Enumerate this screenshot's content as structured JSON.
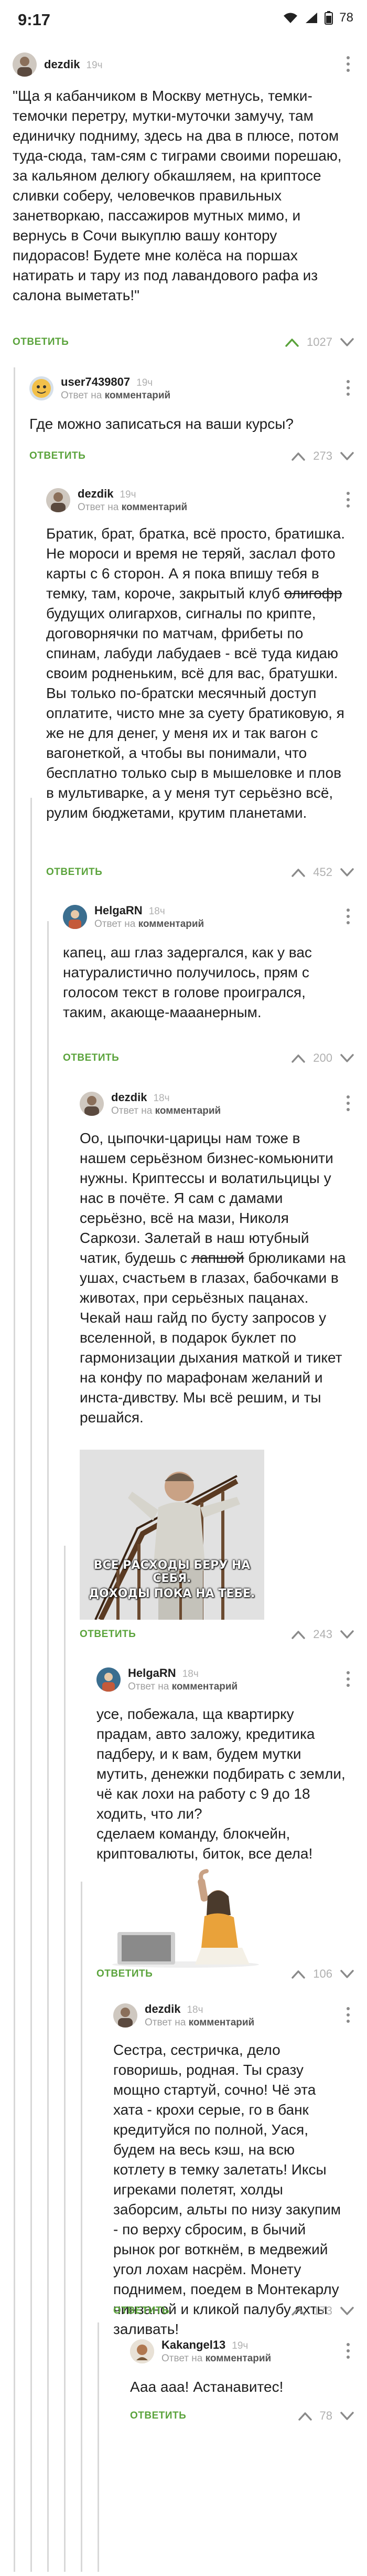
{
  "status_bar": {
    "time": "9:17",
    "battery": "78"
  },
  "reply_label": "ОТВЕТИТЬ",
  "reply_to_prefix": "Ответ на",
  "reply_to_target": "комментарий",
  "comments": [
    {
      "author": "dezdik",
      "age": "19ч",
      "rating": "1027",
      "text": "\"Ща я кабанчиком в Москву метнусь, темки-темочки перетру, мутки-муточки замучу, там единичку подниму, здесь на два в плюсе, потом туда-сюда, там-сям с тиграми своими порешаю, за кальяном делюгу обкашляем, на криптосе сливки соберу, человечков правильных занетворкаю, пассажиров мутных мимо, и вернусь в Сочи выкуплю вашу контору пидорасов! Будете мне колёса на поршах натирать и тару из под лавандового рафа из салона выметать!\""
    },
    {
      "author": "user7439807",
      "age": "19ч",
      "rating": "273",
      "text": "Где можно записаться на ваши курсы?"
    },
    {
      "author": "dezdik",
      "age": "19ч",
      "rating": "452",
      "text_before": "Братик, брат, братка, всё просто, братишка. Не мороси и время не теряй, заслал фото карты с 6 сторон. А я пока впишу тебя в темку, там, короче, закрытый клуб ",
      "text_strike": "олигофр",
      "text_after": " будущих олигархов, сигналы по крипте, договорнячки по матчам, фрибеты по спинам, лабуди лабудаев - всё туда кидаю своим родненьким, всё для вас, братушки. Вы только по-братски месячный доступ оплатите, чисто мне за суету братиковую, я же не для денег, у меня их и так вагон с вагонеткой, а чтобы вы понимали, что бесплатно только сыр в мышеловке и плов в мультиварке, а у меня тут серьёзно всё, рулим бюджетами, крутим планетами."
    },
    {
      "author": "HelgaRN",
      "age": "18ч",
      "rating": "200",
      "text": "капец, аш глаз задергался, как у вас натуралистично получилось, прям с голосом текст в голове проигрался, таким, акающе-мааанерным."
    },
    {
      "author": "dezdik",
      "age": "18ч",
      "rating": "243",
      "text_before": "Оо, цыпочки-царицы нам тоже в нашем серьёзном бизнес-комьюнити нужны. Криптессы и волатильцицы у нас в почёте. Я сам с дамами серьёзно, всё на мази, Николя Саркози. Залетай в наш ютубный чатик, будешь с ",
      "text_strike": "лапшой",
      "text_after": " брюликами на ушах, счастьем в глазах, бабочками в животах, при серьёзных пацанах. Чекай наш гайд по бусту запросов у вселенной, в подарок буклет по гармонизации дыхания маткой и тикет на конфу по марафонам желаний и инста-дивству. Мы всё решим, и ты решайся.",
      "image_caption_line1": "ВСЕ РАСХОДЫ БЕРУ НА СЕБЯ.",
      "image_caption_line2": "ДОХОДЫ ПОКА НА ТЕБЕ."
    },
    {
      "author": "HelgaRN",
      "age": "18ч",
      "rating": "106",
      "text": "усе, побежала, ща квартирку прадам, авто заложу, кредитика падберу, и к вам, будем мутки мутить, денежки подбирать с земли, чё как лохи на работу с 9 до 18 ходить, что ли?\nсделаем команду, блокчейн, криптовалюты, биток, все дела!"
    },
    {
      "author": "dezdik",
      "age": "18ч",
      "rating": "173",
      "text": "Сестра, сестричка, дело говоришь, родная. Ты сразу мощно стартуй, сочно! Чё эта хата - крохи серые, го в банк кредитуйся по полной, Уася, будем на весь кэш, на всю котлету в темку залетать! Иксы игреками полетят, холды заборсим, альты по низу закупим - по верху сбросим, в бычий рынок рог воткнём, в медвежий угол лохам насрём. Монету поднимем, поедем в Монтекарлу чинзаной и кликой палубу яхты заливать!"
    },
    {
      "author": "Kakangel13",
      "age": "19ч",
      "rating": "78",
      "text": "Ааа ааа! Астанавитес!"
    }
  ],
  "colors": {
    "accent_green": "#5aa33b",
    "thread_line": "#d8d8d8",
    "muted": "#b0b0b0"
  },
  "icons": [
    "wifi-icon",
    "signal-icon",
    "battery-icon",
    "more-vert-icon",
    "chevron-up-icon",
    "chevron-down-icon",
    "avatar-icon"
  ]
}
